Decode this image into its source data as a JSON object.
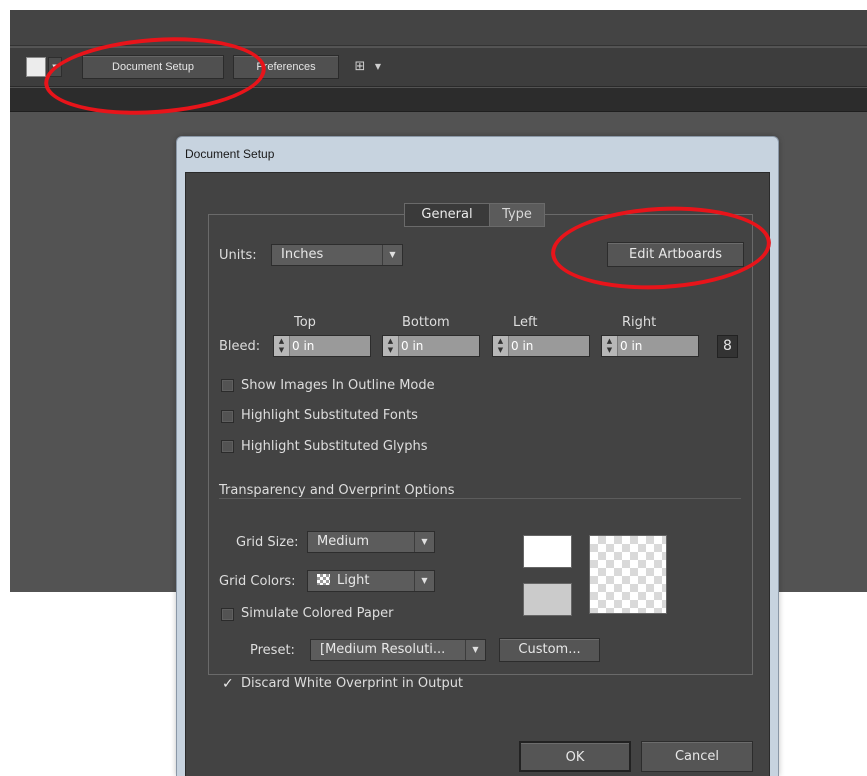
{
  "toolbar": {
    "document_setup_label": "Document Setup",
    "preferences_label": "Preferences",
    "arrange_icon": "arrange-documents-icon"
  },
  "dialog": {
    "title": "Document Setup",
    "tabs": [
      {
        "label": "General",
        "selected": true
      },
      {
        "label": "Type",
        "selected": false
      }
    ],
    "units": {
      "label": "Units:",
      "value": "Inches"
    },
    "edit_artboards_label": "Edit Artboards",
    "bleed": {
      "label": "Bleed:",
      "top": {
        "label": "Top",
        "value": "0 in"
      },
      "bottom": {
        "label": "Bottom",
        "value": "0 in"
      },
      "left": {
        "label": "Left",
        "value": "0 in"
      },
      "right": {
        "label": "Right",
        "value": "0 in"
      }
    },
    "options": [
      {
        "label": "Show Images In Outline Mode",
        "checked": false
      },
      {
        "label": "Highlight Substituted Fonts",
        "checked": false
      },
      {
        "label": "Highlight Substituted Glyphs",
        "checked": false
      }
    ],
    "transparency": {
      "section_label": "Transparency and Overprint Options",
      "grid_size": {
        "label": "Grid Size:",
        "value": "Medium"
      },
      "grid_colors": {
        "label": "Grid Colors:",
        "value": "Light"
      },
      "simulate_paper": {
        "label": "Simulate Colored Paper",
        "checked": false
      },
      "preset": {
        "label": "Preset:",
        "value": "[Medium Resoluti..."
      },
      "custom_label": "Custom...",
      "discard_white": {
        "label": "Discard White Overprint in Output",
        "checked": true
      }
    },
    "ok_label": "OK",
    "cancel_label": "Cancel"
  },
  "colors": {
    "annotation": "#e8141a",
    "panel": "#434343",
    "title_bar": "#c7d3df"
  }
}
